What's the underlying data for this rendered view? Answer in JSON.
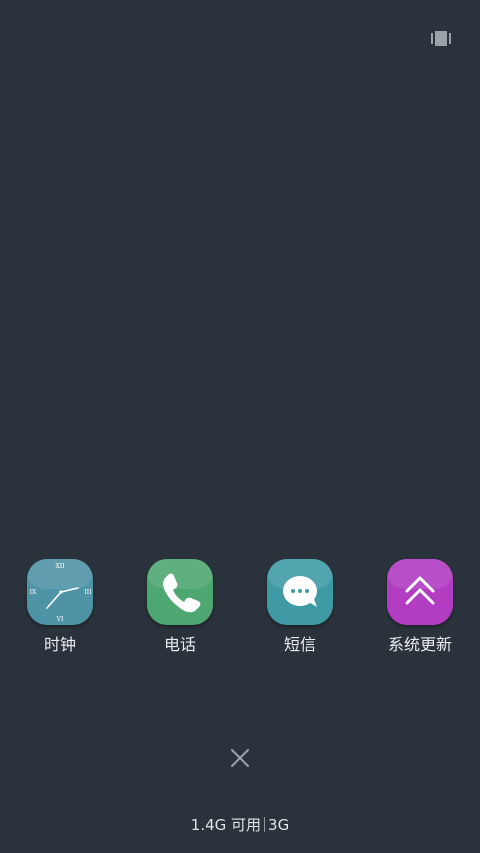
{
  "apps": [
    {
      "label": "时钟",
      "icon": "clock-icon",
      "color": "#4f93a6"
    },
    {
      "label": "电话",
      "icon": "phone-icon",
      "color": "#4ea671"
    },
    {
      "label": "短信",
      "icon": "message-icon",
      "color": "#3f9aa6"
    },
    {
      "label": "系统更新",
      "icon": "system-update-icon",
      "color": "#b23cc2"
    }
  ],
  "memory": {
    "available": "1.4G 可用",
    "total": "3G"
  },
  "clock_numerals": {
    "top": "XII",
    "right": "III",
    "bottom": "VI",
    "left": "IX"
  }
}
